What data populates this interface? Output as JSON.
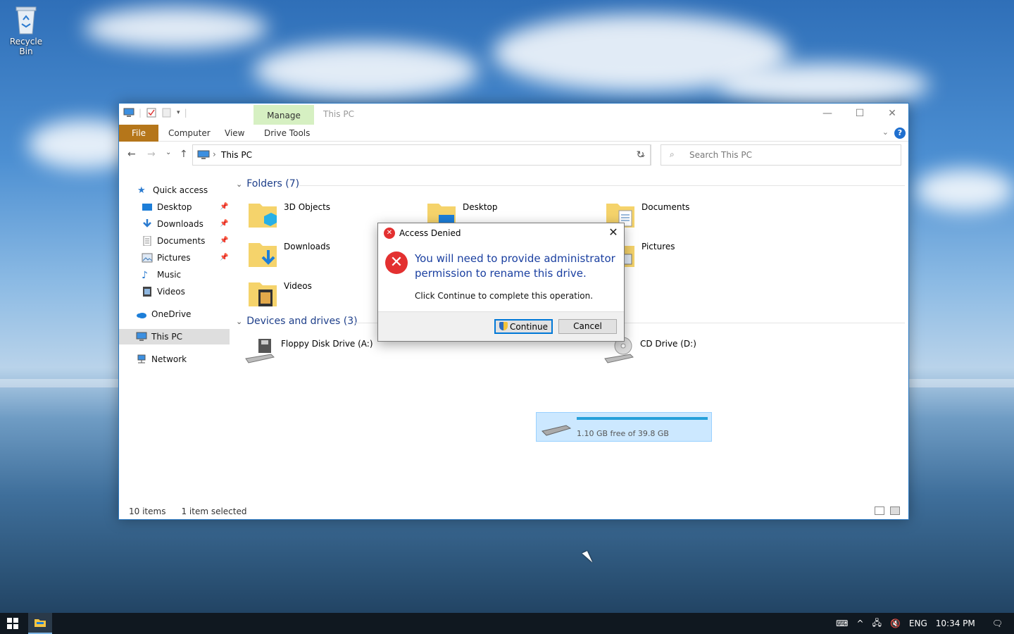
{
  "desktop": {
    "recycle_bin_label": "Recycle Bin"
  },
  "window": {
    "title": "This PC",
    "ribbon": {
      "context_tab": "Manage",
      "tabs": [
        "File",
        "Computer",
        "View",
        "Drive Tools"
      ]
    },
    "address": {
      "crumb": "This PC",
      "search_placeholder": "Search This PC"
    },
    "nav": {
      "items": [
        {
          "label": "Quick access",
          "icon": "star-icon"
        },
        {
          "label": "Desktop",
          "icon": "desktop-icon"
        },
        {
          "label": "Downloads",
          "icon": "download-icon"
        },
        {
          "label": "Documents",
          "icon": "document-icon"
        },
        {
          "label": "Pictures",
          "icon": "pictures-icon"
        },
        {
          "label": "Music",
          "icon": "music-icon"
        },
        {
          "label": "Videos",
          "icon": "video-icon"
        },
        {
          "label": "OneDrive",
          "icon": "cloud-icon"
        },
        {
          "label": "This PC",
          "icon": "pc-icon"
        },
        {
          "label": "Network",
          "icon": "network-icon"
        }
      ]
    },
    "folders_header": "Folders (7)",
    "folders": [
      {
        "label": "3D Objects"
      },
      {
        "label": "Desktop"
      },
      {
        "label": "Documents"
      },
      {
        "label": "Downloads"
      },
      {
        "label": "Pictures"
      },
      {
        "label": "Videos"
      }
    ],
    "devices_header": "Devices and drives (3)",
    "drives": {
      "floppy": "Floppy Disk Drive (A:)",
      "local_free": "1.10 GB free of 39.8 GB",
      "cd": "CD Drive (D:)"
    },
    "status": {
      "items": "10 items",
      "selected": "1 item selected"
    }
  },
  "dialog": {
    "title": "Access Denied",
    "main": "You will need to provide administrator permission to rename this drive.",
    "sub": "Click Continue to complete this operation.",
    "continue_label": "Continue",
    "cancel_label": "Cancel"
  },
  "taskbar": {
    "lang": "ENG",
    "time": "10:34 PM"
  },
  "colors": {
    "accent": "#0078d7",
    "file_tab": "#b5761a",
    "manage_tab": "#d6f0c2",
    "error_red": "#e33030",
    "group_header": "#1e3f8a"
  }
}
